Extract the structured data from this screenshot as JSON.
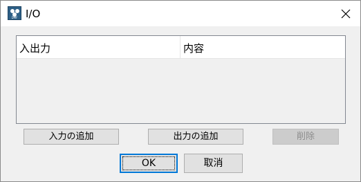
{
  "window": {
    "title": "I/O",
    "icon": "app-icon",
    "icon_tag": "DMF"
  },
  "list": {
    "columns": [
      "入出力",
      "内容"
    ],
    "rows": []
  },
  "buttons": {
    "add_input": "入力の追加",
    "add_output": "出力の追加",
    "delete": "削除",
    "ok": "OK",
    "cancel": "取消"
  },
  "colors": {
    "focus_accent": "#0078d7",
    "button_face": "#e1e1e1",
    "dialog_background": "#f0f0f0"
  }
}
